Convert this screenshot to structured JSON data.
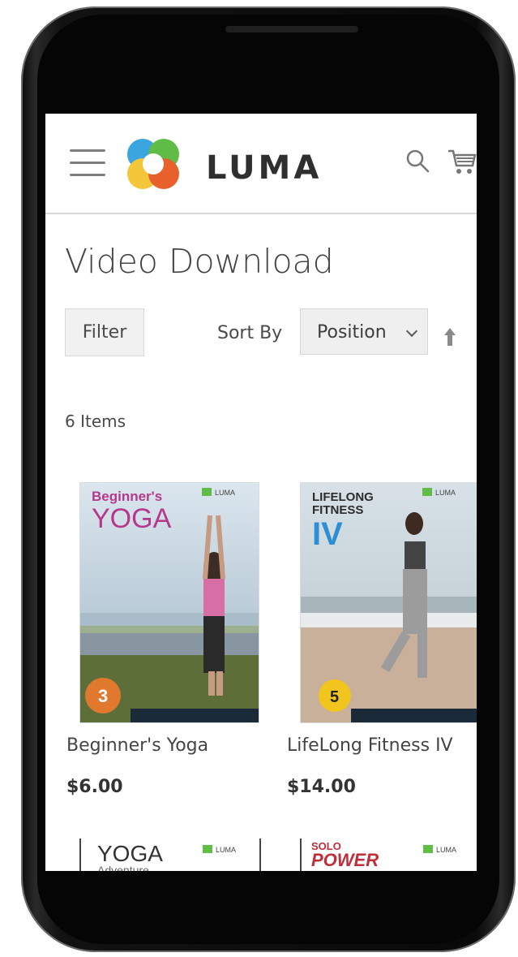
{
  "header": {
    "menu_icon": "hamburger-icon",
    "logo_text": "LUMA",
    "search_icon": "search-icon",
    "cart_icon": "cart-icon"
  },
  "page": {
    "title": "Video Download"
  },
  "toolbar": {
    "filter_label": "Filter",
    "sort_label": "Sort By",
    "sort_value": "Position",
    "sort_direction_icon": "arrow-up-icon",
    "items_count": "6 Items"
  },
  "products": [
    {
      "name": "Beginner's Yoga",
      "price": "$6.00",
      "cover": {
        "title_line1": "Beginner's",
        "title_line2": "YOGA",
        "badge": "3",
        "brand": "LUMA"
      }
    },
    {
      "name": "LifeLong Fitness IV",
      "price": "$14.00",
      "cover": {
        "title_line1": "LIFELONG",
        "title_line2": "FITNESS",
        "title_line3": "IV",
        "badge": "5",
        "brand": "LUMA"
      }
    }
  ],
  "partial_products": [
    {
      "cover_title": "YOGA",
      "cover_subtitle": "Adventure",
      "brand": "LUMA"
    },
    {
      "cover_title_line1": "SOLO",
      "cover_title_line2": "POWER",
      "brand": "LUMA"
    }
  ],
  "colors": {
    "yoga_magenta": "#b6388a",
    "fitness_blue": "#2c8fd6",
    "badge_orange": "#e0782e",
    "badge_yellow": "#f1c51d"
  }
}
